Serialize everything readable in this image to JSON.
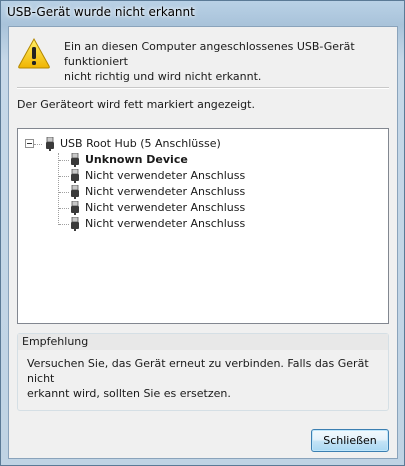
{
  "window": {
    "title": "USB-Gerät wurde nicht erkannt"
  },
  "header": {
    "icon": "warning-icon",
    "message": "Ein an diesen Computer angeschlossenes USB-Gerät funktioniert\nnicht richtig und wird nicht erkannt."
  },
  "info": {
    "text": "Der Geräteort wird fett markiert angezeigt."
  },
  "tree": {
    "root": {
      "label": "USB Root Hub (5 Anschlüsse)",
      "icon": "usb-plug-icon",
      "expanded": true
    },
    "children": [
      {
        "label": "Unknown Device",
        "bold": true,
        "icon": "usb-plug-icon"
      },
      {
        "label": "Nicht verwendeter Anschluss",
        "bold": false,
        "icon": "usb-plug-icon"
      },
      {
        "label": "Nicht verwendeter Anschluss",
        "bold": false,
        "icon": "usb-plug-icon"
      },
      {
        "label": "Nicht verwendeter Anschluss",
        "bold": false,
        "icon": "usb-plug-icon"
      },
      {
        "label": "Nicht verwendeter Anschluss",
        "bold": false,
        "icon": "usb-plug-icon"
      }
    ]
  },
  "recommendation": {
    "title": "Empfehlung",
    "text": "Versuchen Sie, das Gerät erneut zu verbinden. Falls das Gerät nicht\nerkannt wird, sollten Sie es ersetzen."
  },
  "buttons": {
    "close": "Schließen"
  },
  "colors": {
    "accent": "#3c7fb1",
    "warning": "#f3c300"
  }
}
